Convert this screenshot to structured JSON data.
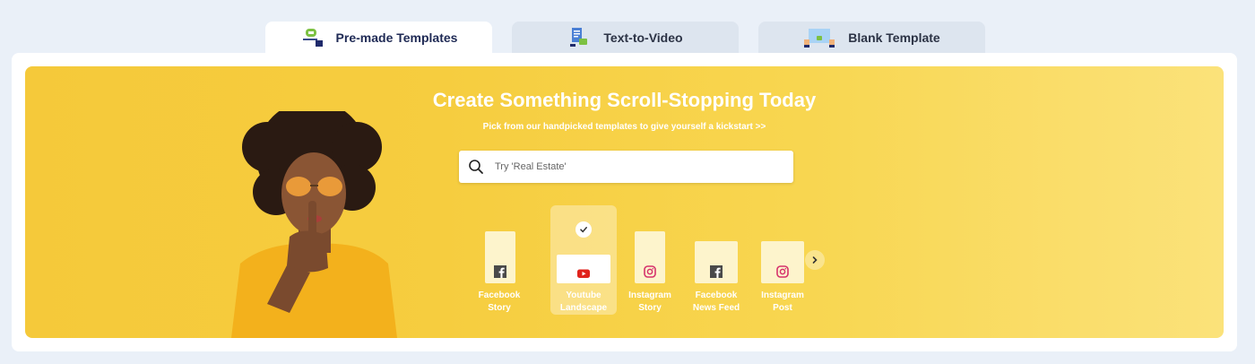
{
  "tabs": [
    {
      "label": "Pre-made Templates",
      "active": true,
      "icon": "premade-templates-icon"
    },
    {
      "label": "Text-to-Video",
      "active": false,
      "icon": "text-to-video-icon"
    },
    {
      "label": "Blank Template",
      "active": false,
      "icon": "blank-template-icon"
    }
  ],
  "hero": {
    "title": "Create Something Scroll-Stopping Today",
    "subtitle": "Pick from our handpicked templates to give yourself a kickstart >>"
  },
  "search": {
    "placeholder": "Try 'Real Estate'",
    "value": ""
  },
  "formats": [
    {
      "line1": "Facebook",
      "line2": "Story",
      "icon": "facebook-icon",
      "selected": false
    },
    {
      "line1": "Youtube",
      "line2": "Landscape",
      "icon": "youtube-icon",
      "selected": true
    },
    {
      "line1": "Instagram",
      "line2": "Story",
      "icon": "instagram-icon",
      "selected": false
    },
    {
      "line1": "Facebook",
      "line2": "News Feed",
      "icon": "facebook-icon",
      "selected": false
    },
    {
      "line1": "Instagram",
      "line2": "Post",
      "icon": "instagram-icon",
      "selected": false
    }
  ],
  "colors": {
    "hero_yellow": "#f6cd3f",
    "facebook": "#4a4a4a",
    "youtube": "#e0231c",
    "instagram": "#d6336c"
  }
}
